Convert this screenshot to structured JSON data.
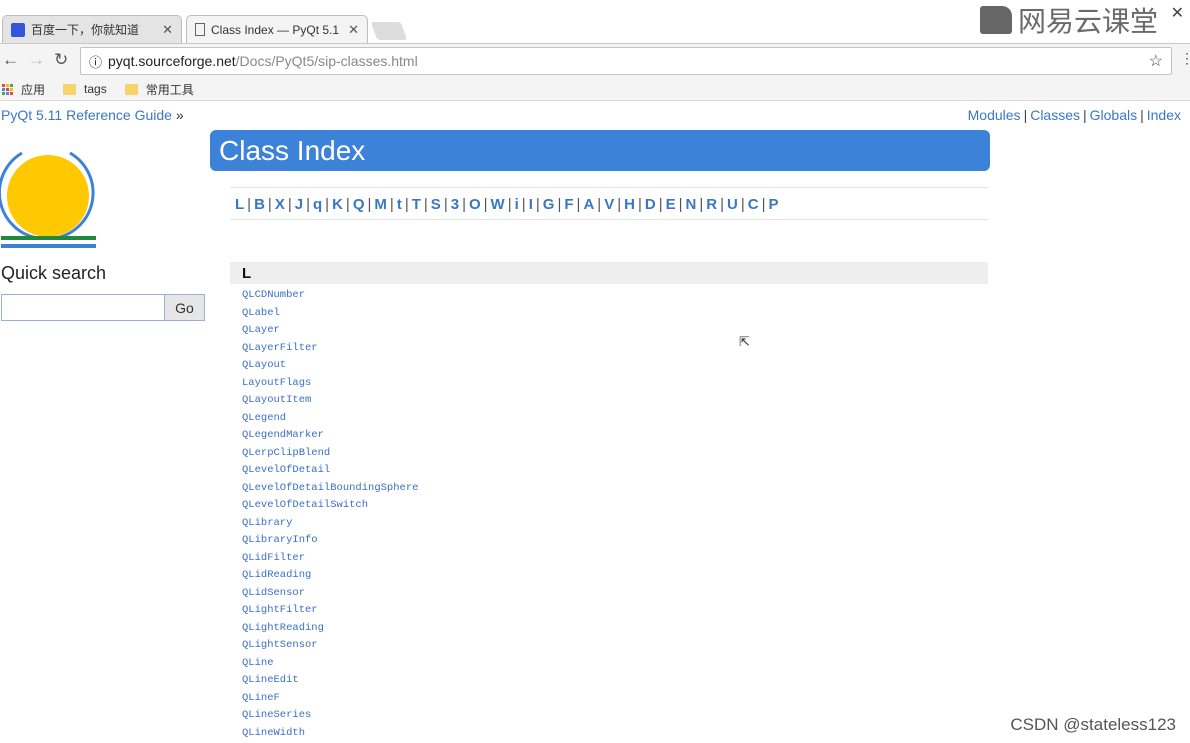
{
  "browser": {
    "tabs": [
      {
        "label": "百度一下，你就知道",
        "icon": "paw-icon",
        "active": false
      },
      {
        "label": "Class Index — PyQt 5.1",
        "icon": "page-icon",
        "active": true
      }
    ],
    "url_host": "pyqt.sourceforge.net",
    "url_path": "/Docs/PyQt5/sip-classes.html",
    "bookmarks": [
      {
        "label": "应用",
        "icon": "apps-icon"
      },
      {
        "label": "tags",
        "icon": "folder-icon"
      },
      {
        "label": "常用工具",
        "icon": "folder-icon"
      }
    ]
  },
  "page": {
    "breadcrumb": "PyQt 5.11 Reference Guide",
    "breadcrumb_sep": "»",
    "top_links": [
      "Modules",
      "Classes",
      "Globals",
      "Index"
    ],
    "sidebar": {
      "quick_search": "Quick search",
      "go_label": "Go",
      "search_value": ""
    },
    "title": "Class Index",
    "letters": [
      "L",
      "B",
      "X",
      "J",
      "q",
      "K",
      "Q",
      "M",
      "t",
      "T",
      "S",
      "3",
      "O",
      "W",
      "i",
      "I",
      "G",
      "F",
      "A",
      "V",
      "H",
      "D",
      "E",
      "N",
      "R",
      "U",
      "C",
      "P"
    ],
    "section": {
      "letter": "L",
      "classes": [
        "QLCDNumber",
        "QLabel",
        "QLayer",
        "QLayerFilter",
        "QLayout",
        "LayoutFlags",
        "QLayoutItem",
        "QLegend",
        "QLegendMarker",
        "QLerpClipBlend",
        "QLevelOfDetail",
        "QLevelOfDetailBoundingSphere",
        "QLevelOfDetailSwitch",
        "QLibrary",
        "QLibraryInfo",
        "QLidFilter",
        "QLidReading",
        "QLidSensor",
        "QLightFilter",
        "QLightReading",
        "QLightSensor",
        "QLine",
        "QLineEdit",
        "QLineF",
        "QLineSeries",
        "QLineWidth"
      ]
    }
  },
  "watermarks": {
    "top": "网易云课堂",
    "bottom": "CSDN @stateless123"
  },
  "colors": {
    "link": "#3a77c6",
    "header": "#3b82d8",
    "logo_sun": "#ffc800"
  }
}
